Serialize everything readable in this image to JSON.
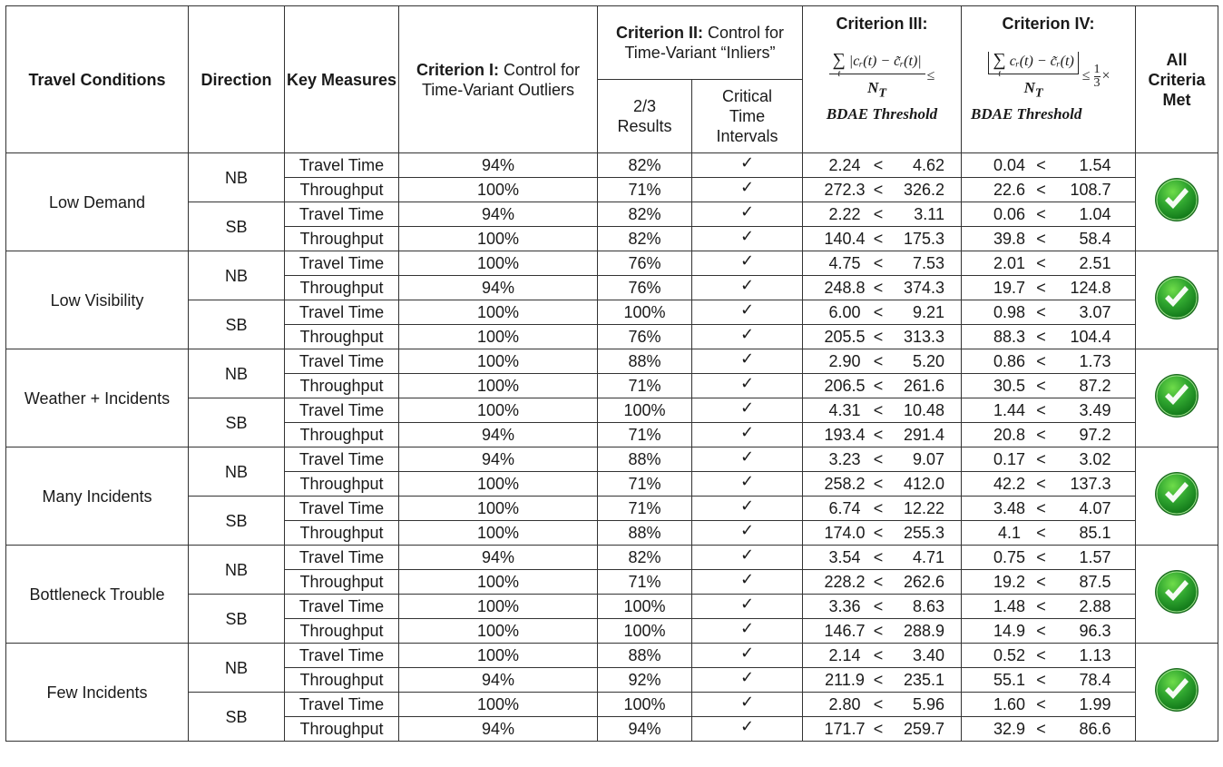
{
  "header": {
    "travel_conditions": "Travel Conditions",
    "direction": "Direction",
    "key_measures": "Key Measures",
    "criterion1_bold": "Criterion I:",
    "criterion1_rest": " Control for Time-Variant Outliers",
    "criterion2_bold": "Criterion II:",
    "criterion2_rest": " Control for Time-Variant “Inliers”",
    "criterion2_sub1": "2/3 Results",
    "criterion2_sub2": "Critical Time Intervals",
    "criterion3_title": "Criterion III:",
    "criterion3_formula_num": "|cᵣ(t) − c̃ᵣ(t)|",
    "criterion3_formula_den": "N",
    "criterion3_formula_den_sub": "T",
    "criterion3_relation": "≤",
    "criterion3_threshold": "BDAE Threshold",
    "criterion4_title": "Criterion IV:",
    "criterion4_formula_num": "cᵣ(t) − c̃ᵣ(t)",
    "criterion4_formula_den": "N",
    "criterion4_formula_den_sub": "T",
    "criterion4_relation": "≤",
    "criterion4_fraction_num": "1",
    "criterion4_fraction_den": "3",
    "criterion4_times": "×",
    "criterion4_threshold": "BDAE Threshold",
    "sigma": "∑",
    "sigma_sub": "t",
    "all_criteria_met": "All Criteria Met"
  },
  "check_symbol": "✓",
  "less_than": "<",
  "status_icon": "green-check-circle",
  "status_color": "#2fa52f",
  "conditions": [
    {
      "name": "Low Demand",
      "all_met": true,
      "directions": [
        {
          "dir": "NB",
          "rows": [
            {
              "measure": "Travel Time",
              "c1": "94%",
              "c2": "82%",
              "critical": true,
              "c3a": "2.24",
              "c3b": "4.62",
              "c4a": "0.04",
              "c4b": "1.54"
            },
            {
              "measure": "Throughput",
              "c1": "100%",
              "c2": "71%",
              "critical": true,
              "c3a": "272.3",
              "c3b": "326.2",
              "c4a": "22.6",
              "c4b": "108.7"
            }
          ]
        },
        {
          "dir": "SB",
          "rows": [
            {
              "measure": "Travel Time",
              "c1": "94%",
              "c2": "82%",
              "critical": true,
              "c3a": "2.22",
              "c3b": "3.11",
              "c4a": "0.06",
              "c4b": "1.04"
            },
            {
              "measure": "Throughput",
              "c1": "100%",
              "c2": "82%",
              "critical": true,
              "c3a": "140.4",
              "c3b": "175.3",
              "c4a": "39.8",
              "c4b": "58.4"
            }
          ]
        }
      ]
    },
    {
      "name": "Low Visibility",
      "all_met": true,
      "directions": [
        {
          "dir": "NB",
          "rows": [
            {
              "measure": "Travel Time",
              "c1": "100%",
              "c2": "76%",
              "critical": true,
              "c3a": "4.75",
              "c3b": "7.53",
              "c4a": "2.01",
              "c4b": "2.51"
            },
            {
              "measure": "Throughput",
              "c1": "94%",
              "c2": "76%",
              "critical": true,
              "c3a": "248.8",
              "c3b": "374.3",
              "c4a": "19.7",
              "c4b": "124.8"
            }
          ]
        },
        {
          "dir": "SB",
          "rows": [
            {
              "measure": "Travel Time",
              "c1": "100%",
              "c2": "100%",
              "critical": true,
              "c3a": "6.00",
              "c3b": "9.21",
              "c4a": "0.98",
              "c4b": "3.07"
            },
            {
              "measure": "Throughput",
              "c1": "100%",
              "c2": "76%",
              "critical": true,
              "c3a": "205.5",
              "c3b": "313.3",
              "c4a": "88.3",
              "c4b": "104.4"
            }
          ]
        }
      ]
    },
    {
      "name": "Weather + Incidents",
      "all_met": true,
      "directions": [
        {
          "dir": "NB",
          "rows": [
            {
              "measure": "Travel Time",
              "c1": "100%",
              "c2": "88%",
              "critical": true,
              "c3a": "2.90",
              "c3b": "5.20",
              "c4a": "0.86",
              "c4b": "1.73"
            },
            {
              "measure": "Throughput",
              "c1": "100%",
              "c2": "71%",
              "critical": true,
              "c3a": "206.5",
              "c3b": "261.6",
              "c4a": "30.5",
              "c4b": "87.2"
            }
          ]
        },
        {
          "dir": "SB",
          "rows": [
            {
              "measure": "Travel Time",
              "c1": "100%",
              "c2": "100%",
              "critical": true,
              "c3a": "4.31",
              "c3b": "10.48",
              "c4a": "1.44",
              "c4b": "3.49"
            },
            {
              "measure": "Throughput",
              "c1": "94%",
              "c2": "71%",
              "critical": true,
              "c3a": "193.4",
              "c3b": "291.4",
              "c4a": "20.8",
              "c4b": "97.2"
            }
          ]
        }
      ]
    },
    {
      "name": "Many Incidents",
      "all_met": true,
      "directions": [
        {
          "dir": "NB",
          "rows": [
            {
              "measure": "Travel Time",
              "c1": "94%",
              "c2": "88%",
              "critical": true,
              "c3a": "3.23",
              "c3b": "9.07",
              "c4a": "0.17",
              "c4b": "3.02"
            },
            {
              "measure": "Throughput",
              "c1": "100%",
              "c2": "71%",
              "critical": true,
              "c3a": "258.2",
              "c3b": "412.0",
              "c4a": "42.2",
              "c4b": "137.3"
            }
          ]
        },
        {
          "dir": "SB",
          "rows": [
            {
              "measure": "Travel Time",
              "c1": "100%",
              "c2": "71%",
              "critical": true,
              "c3a": "6.74",
              "c3b": "12.22",
              "c4a": "3.48",
              "c4b": "4.07"
            },
            {
              "measure": "Throughput",
              "c1": "100%",
              "c2": "88%",
              "critical": true,
              "c3a": "174.0",
              "c3b": "255.3",
              "c4a": "4.1",
              "c4b": "85.1"
            }
          ]
        }
      ]
    },
    {
      "name": "Bottleneck Trouble",
      "all_met": true,
      "directions": [
        {
          "dir": "NB",
          "rows": [
            {
              "measure": "Travel Time",
              "c1": "94%",
              "c2": "82%",
              "critical": true,
              "c3a": "3.54",
              "c3b": "4.71",
              "c4a": "0.75",
              "c4b": "1.57"
            },
            {
              "measure": "Throughput",
              "c1": "100%",
              "c2": "71%",
              "critical": true,
              "c3a": "228.2",
              "c3b": "262.6",
              "c4a": "19.2",
              "c4b": "87.5"
            }
          ]
        },
        {
          "dir": "SB",
          "rows": [
            {
              "measure": "Travel Time",
              "c1": "100%",
              "c2": "100%",
              "critical": true,
              "c3a": "3.36",
              "c3b": "8.63",
              "c4a": "1.48",
              "c4b": "2.88"
            },
            {
              "measure": "Throughput",
              "c1": "100%",
              "c2": "100%",
              "critical": true,
              "c3a": "146.7",
              "c3b": "288.9",
              "c4a": "14.9",
              "c4b": "96.3"
            }
          ]
        }
      ]
    },
    {
      "name": "Few Incidents",
      "all_met": true,
      "directions": [
        {
          "dir": "NB",
          "rows": [
            {
              "measure": "Travel Time",
              "c1": "100%",
              "c2": "88%",
              "critical": true,
              "c3a": "2.14",
              "c3b": "3.40",
              "c4a": "0.52",
              "c4b": "1.13"
            },
            {
              "measure": "Throughput",
              "c1": "94%",
              "c2": "92%",
              "critical": true,
              "c3a": "211.9",
              "c3b": "235.1",
              "c4a": "55.1",
              "c4b": "78.4"
            }
          ]
        },
        {
          "dir": "SB",
          "rows": [
            {
              "measure": "Travel Time",
              "c1": "100%",
              "c2": "100%",
              "critical": true,
              "c3a": "2.80",
              "c3b": "5.96",
              "c4a": "1.60",
              "c4b": "1.99"
            },
            {
              "measure": "Throughput",
              "c1": "94%",
              "c2": "94%",
              "critical": true,
              "c3a": "171.7",
              "c3b": "259.7",
              "c4a": "32.9",
              "c4b": "86.6"
            }
          ]
        }
      ]
    }
  ]
}
